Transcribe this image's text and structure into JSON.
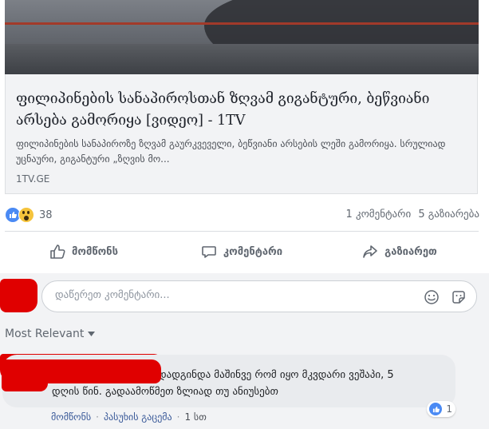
{
  "post": {
    "link_title": "ფილიპინების სანაპიროსთან ზღვამ გიგანტური, ბეწვიანი არსება გამორიყა [ვიდეო] - 1TV",
    "link_description": "ფილიპინების სანაპიროზე ზღვამ გაურკვეველი, ბეწვიანი არსების ლეში გამორიყა. სრულიად უცნაური, გიგანტური „ზღვის მო...",
    "link_source": "1TV.GE"
  },
  "reactions": {
    "count": "38",
    "icons": [
      "like-icon",
      "wow-icon"
    ]
  },
  "stats": {
    "comments": "1 კომენტარი",
    "shares": "5 გაზიარება"
  },
  "actions": {
    "like": "მომწონს",
    "comment": "კომენტარი",
    "share": "გაზიარეთ"
  },
  "composer": {
    "placeholder": "დაწერეთ კომენტარი..."
  },
  "sort": {
    "label": "Most Relevant"
  },
  "comment": {
    "text_line1": "დადგინდა მაშინვე რომ იყო მკვდარი ვეშაპი, 5",
    "text_line2": "დღის წინ. გადაამოწმეთ ზლიად თუ ანიუსებთ",
    "reaction_count": "1",
    "like_label": "მომწონს",
    "reply_label": "პასუხის გაცემა",
    "separator": "·",
    "time": "1 სთ"
  },
  "colors": {
    "accent": "#4a8af4",
    "link": "#385898",
    "redaction": "#e00000"
  }
}
